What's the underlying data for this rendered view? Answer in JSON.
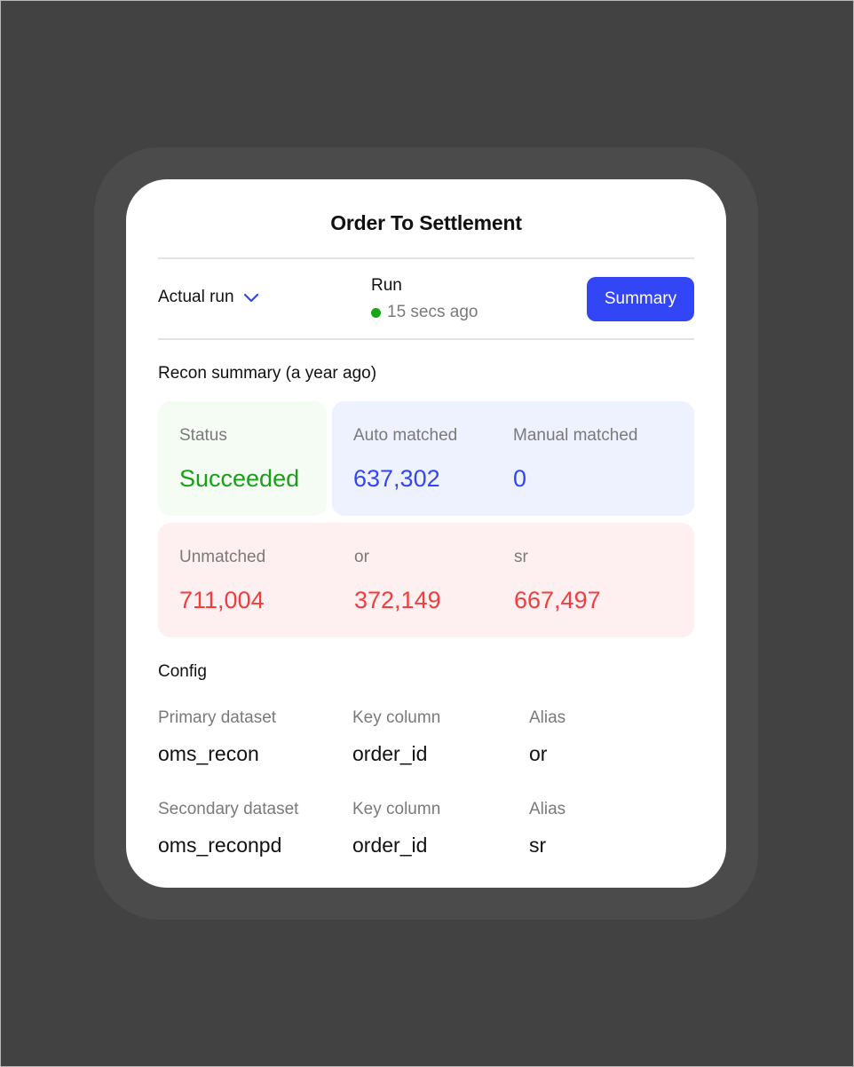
{
  "card": {
    "title": "Order To Settlement"
  },
  "toolbar": {
    "run_selector": "Actual run",
    "run_label": "Run",
    "run_time": "15 secs ago",
    "run_status_color": "#1aa51a",
    "summary_button": "Summary"
  },
  "recon": {
    "title": "Recon summary (a year ago)",
    "status": {
      "label": "Status",
      "value": "Succeeded",
      "color": "#18a018"
    },
    "auto_matched": {
      "label": "Auto matched",
      "value": "637,302",
      "color": "#3346f5"
    },
    "manual_matched": {
      "label": "Manual matched",
      "value": "0",
      "color": "#3346f5"
    },
    "unmatched": {
      "label": "Unmatched",
      "value": "711,004",
      "color": "#f03e3e"
    },
    "or": {
      "label": "or",
      "value": "372,149",
      "color": "#f03e3e"
    },
    "sr": {
      "label": "sr",
      "value": "667,497",
      "color": "#f03e3e"
    }
  },
  "config": {
    "title": "Config",
    "rows": [
      {
        "dataset_label": "Primary dataset",
        "dataset": "oms_recon",
        "key_label": "Key column",
        "key": "order_id",
        "alias_label": "Alias",
        "alias": "or"
      },
      {
        "dataset_label": "Secondary dataset",
        "dataset": "oms_reconpd",
        "key_label": "Key column",
        "key": "order_id",
        "alias_label": "Alias",
        "alias": "sr"
      }
    ]
  },
  "colors": {
    "accent": "#3346f5",
    "success": "#18a018",
    "danger": "#f03e3e",
    "background": "#424242"
  }
}
